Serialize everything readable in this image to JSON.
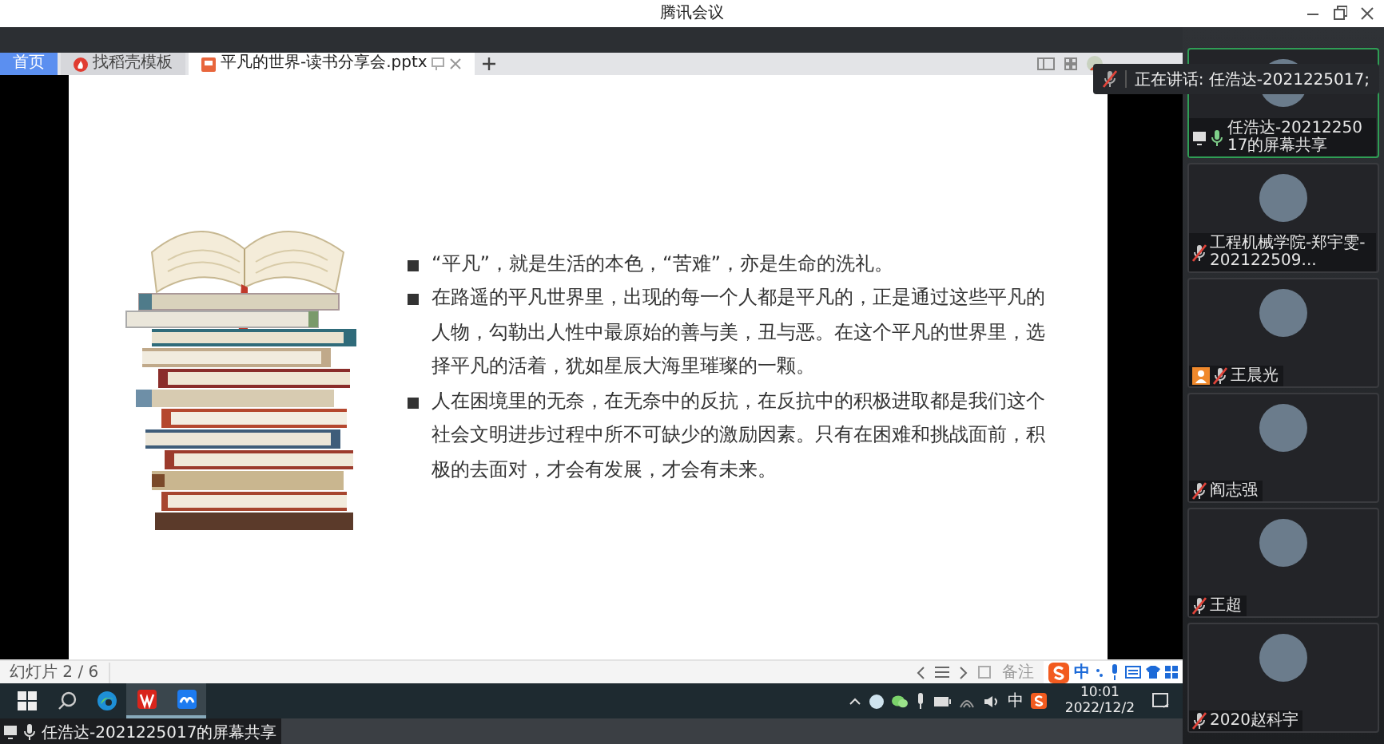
{
  "window": {
    "title": "腾讯会议"
  },
  "app_tabs": [
    {
      "label": "首页",
      "selected": false,
      "kind": "home"
    },
    {
      "label": "找稻壳模板",
      "selected": false,
      "kind": "template"
    },
    {
      "label": "平凡的世界-读书分享会.pptx",
      "selected": true,
      "kind": "presentation"
    }
  ],
  "slide": {
    "bullets": [
      "“平凡”，就是生活的本色，“苦难”，亦是生命的洗礼。",
      "在路遥的平凡世界里，出现的每一个人都是平凡的，正是通过这些平凡的人物，勾勒出人性中最原始的善与美，丑与恶。在这个平凡的世界里，选择平凡的活着，犹如星辰大海里璀璨的一颗。",
      "人在困境里的无奈，在无奈中的反抗，在反抗中的积极进取都是我们这个社会文明进步过程中所不可缺少的激励因素。只有在困难和挑战面前，积极的去面对，才会有发展，才会有未来。"
    ]
  },
  "status_bar": {
    "slide_counter": "幻灯片 2 / 6",
    "notes_label": "备注"
  },
  "ime_toolbar": {
    "mode": "中"
  },
  "taskbar": {
    "tray_ime": "中",
    "time": "10:01",
    "date": "2022/12/2"
  },
  "share_caption": {
    "text": "任浩达-2021225017的屏幕共享",
    "muted": false
  },
  "speaking_toast": {
    "text": "正在讲话: 任浩达-2021225017;"
  },
  "participants": [
    {
      "name": "任浩达-2021225017的屏幕共享",
      "muted": false,
      "speaking": true,
      "sharing": true,
      "host": false
    },
    {
      "name": "工程机械学院-郑宇雯-202122509...",
      "muted": true,
      "speaking": false,
      "sharing": false,
      "host": false
    },
    {
      "name": "王晨光",
      "muted": true,
      "speaking": false,
      "sharing": false,
      "host": true
    },
    {
      "name": "阎志强",
      "muted": true,
      "speaking": false,
      "sharing": false,
      "host": false
    },
    {
      "name": "王超",
      "muted": true,
      "speaking": false,
      "sharing": false,
      "host": false
    },
    {
      "name": "2020赵科宇",
      "muted": true,
      "speaking": false,
      "sharing": false,
      "host": false
    }
  ]
}
